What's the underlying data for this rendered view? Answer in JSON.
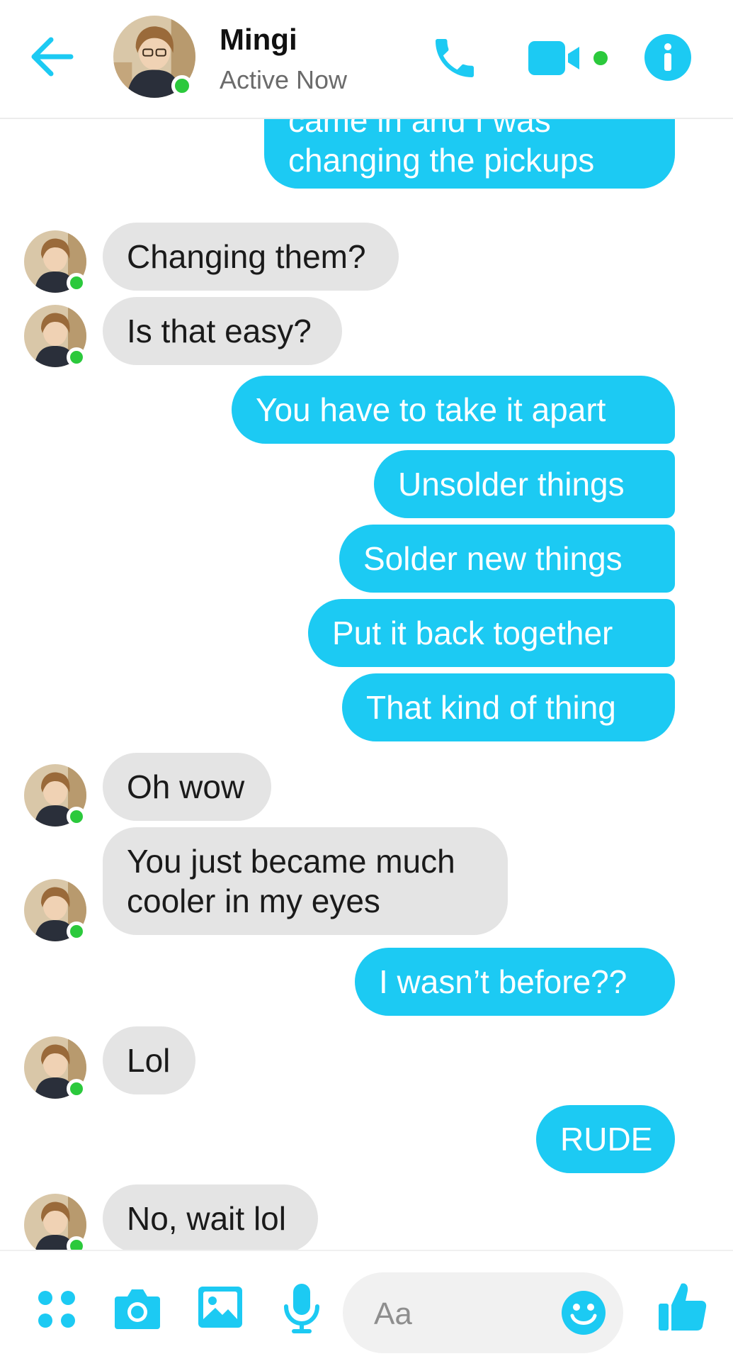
{
  "header": {
    "contact_name": "Mingi",
    "status": "Active Now"
  },
  "icons": {
    "back": "back-arrow-icon",
    "call": "phone-icon",
    "video": "video-camera-icon",
    "info": "info-icon",
    "apps": "apps-grid-icon",
    "camera": "camera-icon",
    "gallery": "gallery-icon",
    "mic": "microphone-icon",
    "emoji": "emoji-icon",
    "like": "thumbs-up-icon"
  },
  "colors": {
    "accent": "#1ccaf3",
    "incoming_bubble": "#e4e4e4",
    "online": "#2bc93c"
  },
  "messages": [
    {
      "from": "me",
      "lines": [
        "came in and I was",
        "changing the pickups"
      ]
    },
    {
      "from": "them",
      "lines": [
        "Changing them?"
      ]
    },
    {
      "from": "them",
      "lines": [
        "Is that easy?"
      ]
    },
    {
      "from": "me",
      "lines": [
        "You have to take it apart"
      ]
    },
    {
      "from": "me",
      "lines": [
        "Unsolder things"
      ]
    },
    {
      "from": "me",
      "lines": [
        "Solder new things"
      ]
    },
    {
      "from": "me",
      "lines": [
        "Put it back together"
      ]
    },
    {
      "from": "me",
      "lines": [
        "That kind of thing"
      ]
    },
    {
      "from": "them",
      "lines": [
        "Oh wow"
      ]
    },
    {
      "from": "them",
      "lines": [
        "You just became much",
        "cooler in my eyes"
      ]
    },
    {
      "from": "me",
      "lines": [
        "I wasn’t before??"
      ]
    },
    {
      "from": "them",
      "lines": [
        "Lol"
      ]
    },
    {
      "from": "me",
      "lines": [
        "RUDE"
      ]
    },
    {
      "from": "them",
      "lines": [
        "No, wait lol"
      ]
    }
  ],
  "composer": {
    "placeholder": "Aa"
  }
}
